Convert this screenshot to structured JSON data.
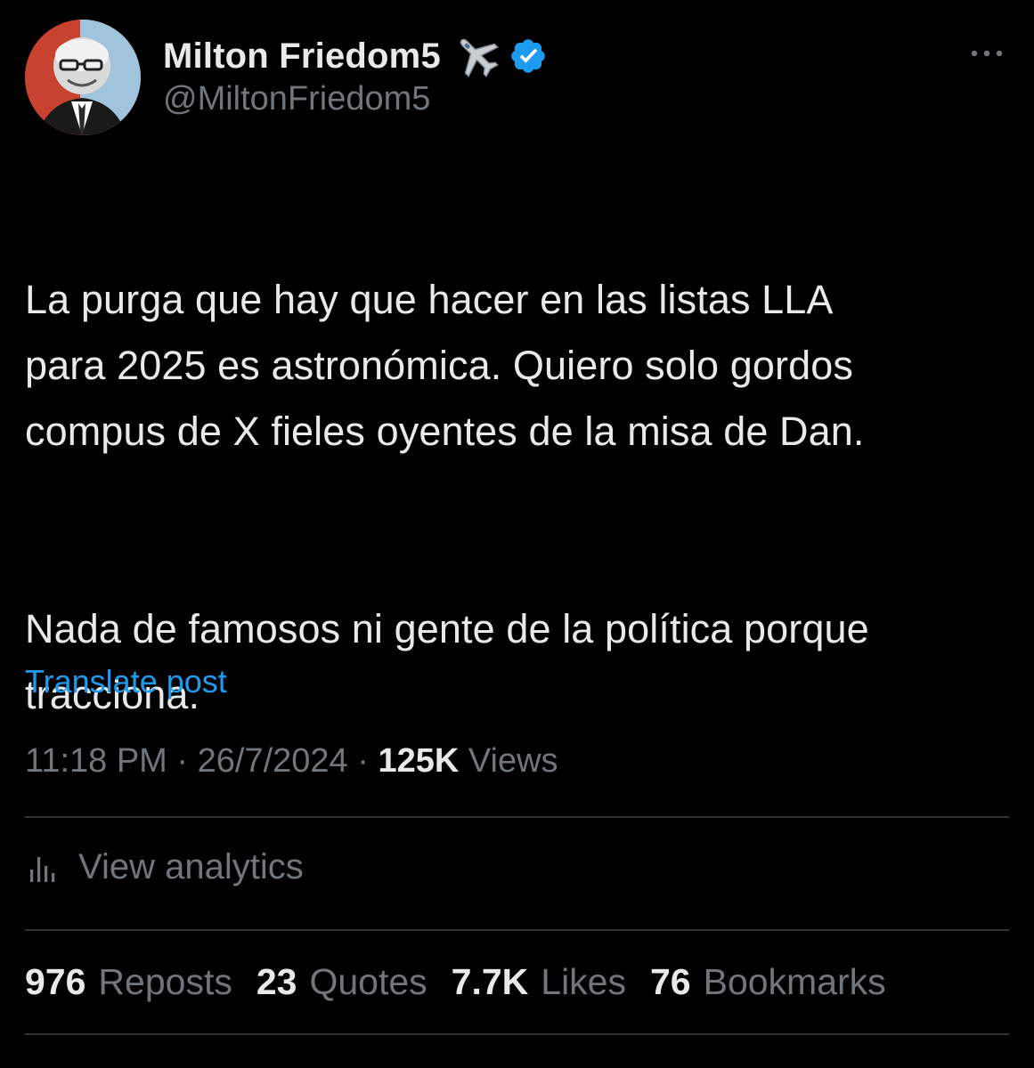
{
  "author": {
    "display_name": "Milton Friedom5",
    "handle": "@MiltonFriedom5",
    "badge_emoji": "airplane-icon",
    "verified": true,
    "verified_color": "#1d9bf0"
  },
  "post": {
    "paragraphs": [
      "La purga que hay que hacer en las listas LLA\npara 2025 es astronómica. Quiero solo gordos\ncompus de X fieles oyentes de la misa de Dan.",
      "Nada de famosos ni gente de la política porque\ntracciona."
    ],
    "translate_label": "Translate post",
    "time": "11:18 PM",
    "separator": "·",
    "date": "26/7/2024",
    "views_count": "125K",
    "views_label": "Views"
  },
  "analytics": {
    "label": "View analytics"
  },
  "stats": [
    {
      "count": "976",
      "label": "Reposts"
    },
    {
      "count": "23",
      "label": "Quotes"
    },
    {
      "count": "7.7K",
      "label": "Likes"
    },
    {
      "count": "76",
      "label": "Bookmarks"
    }
  ],
  "colors": {
    "background": "#000000",
    "primary_text": "#e7e9ea",
    "secondary_text": "#71767b",
    "link": "#1d9bf0",
    "divider": "#2f3336"
  }
}
